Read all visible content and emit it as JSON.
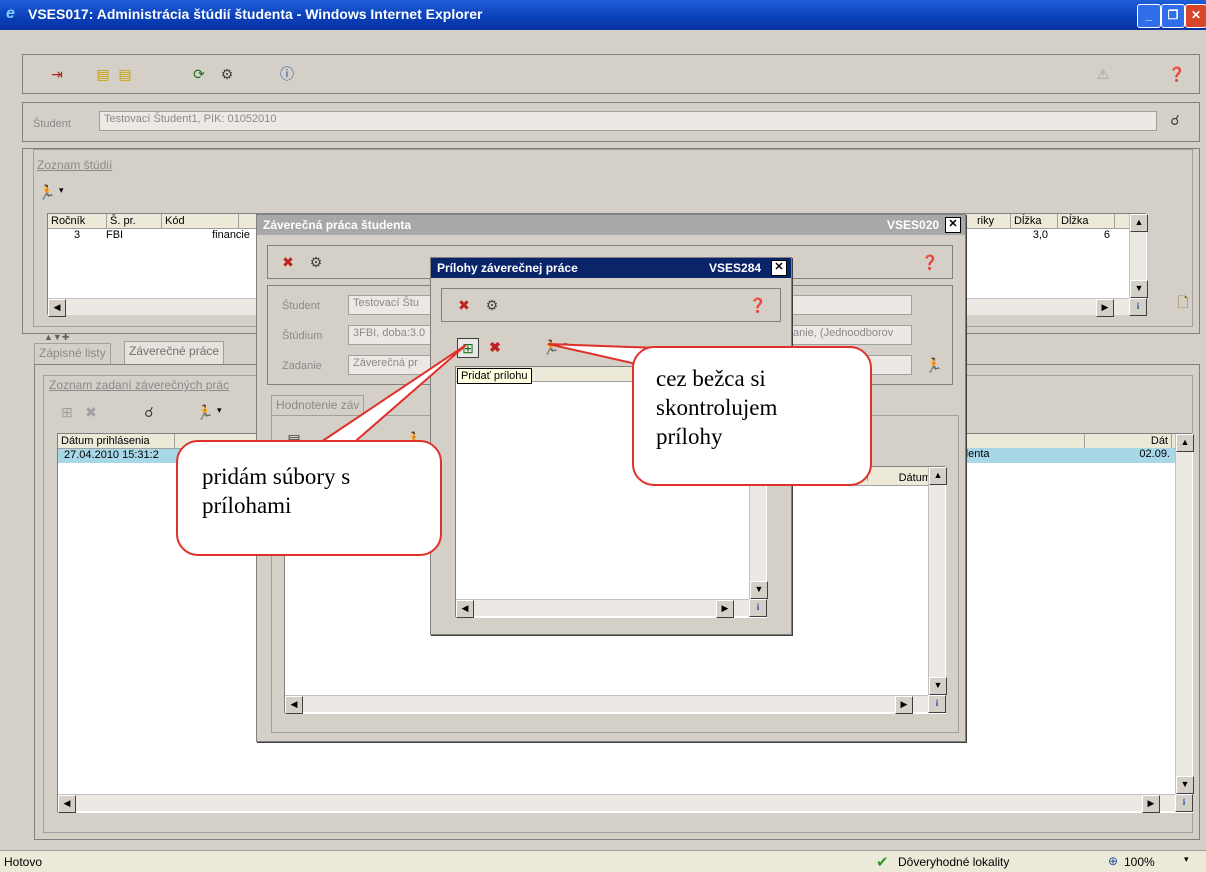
{
  "window": {
    "title": "VSES017: Administrácia štúdií študenta - Windows Internet Explorer"
  },
  "student": {
    "label": "Študent",
    "value": "Testovací Študent1, PIK: 01052010"
  },
  "studies": {
    "group_label": "Zoznam štúdií",
    "columns": [
      "Ročník",
      "Š. pr.",
      "Kód"
    ],
    "row": [
      "3",
      "FBI",
      "financie"
    ],
    "columns_right": [
      "riky",
      "Dĺžka",
      "Dĺžka"
    ],
    "row_right": [
      "3,0",
      "6"
    ]
  },
  "tabs": [
    "Zápisné listy",
    "Záverečné práce"
  ],
  "theses": {
    "group_label": "Zoznam zadaní záverečných prác",
    "column_date": "Dátum prihlásenia",
    "column_right_a": "a",
    "column_right_b": "Dát",
    "row_date": "27.04.2010 15:31:2",
    "row_right_a": "denta",
    "row_right_b": "02.09."
  },
  "dialog1": {
    "title": "Záverečná práca študenta",
    "code": "VSES020",
    "fields": [
      {
        "label": "Študent",
        "value": "Testovací Štu"
      },
      {
        "label": "Štúdium",
        "value": "3FBI, doba:3.0"
      },
      {
        "label": "Zadanie",
        "value": "Záverečná pr"
      }
    ],
    "study_tail": "anie, (Jednoodborov",
    "inner_group": "Hodnotenie záv",
    "col_dat": "Dátum"
  },
  "dialog2": {
    "title": "Prílohy záverečnej práce",
    "code": "VSES284",
    "tooltip": "Pridať prílohu"
  },
  "callouts": {
    "left": "pridám súbory s prílohami",
    "right": "cez bežca si skontrolujem prílohy"
  },
  "status": {
    "left": "Hotovo",
    "zone": "Dôveryhodné lokality",
    "zoom": "100%"
  }
}
